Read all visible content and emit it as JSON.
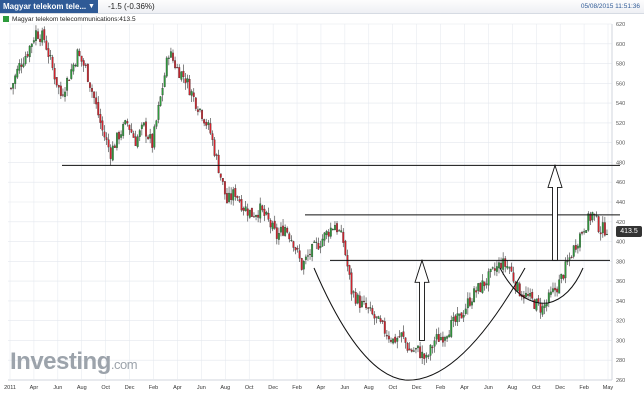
{
  "header": {
    "tab_title": "Magyar telekom tele...",
    "change": "-1.5 (-0.36%)",
    "timestamp": "05/08/2015 11:51:36"
  },
  "legend": {
    "label": "Magyar telekom telecommunications:413.5"
  },
  "price_tag": "413.5",
  "logo": {
    "main": "Investing",
    "suffix": ".com"
  },
  "colors": {
    "up": "#2e9b3c",
    "down": "#d3232d",
    "header_bg": "#2f5a96",
    "grid": "#e3e7ee"
  },
  "chart_data": {
    "type": "candlestick",
    "ylim": [
      260,
      620
    ],
    "y_ticks": [
      260,
      280,
      300,
      320,
      340,
      360,
      380,
      400,
      420,
      440,
      460,
      480,
      500,
      520,
      540,
      560,
      580,
      600,
      620
    ],
    "x_tick_labels": [
      "2011",
      "Apr",
      "Jun",
      "Aug",
      "Oct",
      "Dec",
      "Feb",
      "Apr",
      "Jun",
      "Aug",
      "Oct",
      "Dec",
      "Feb",
      "Apr",
      "Jun",
      "Aug",
      "Oct",
      "Dec",
      "Feb",
      "Apr",
      "Jun",
      "Aug",
      "Oct",
      "Dec",
      "Feb",
      "May"
    ],
    "price_path": [
      [
        0,
        555
      ],
      [
        4,
        578
      ],
      [
        8,
        592
      ],
      [
        12,
        612
      ],
      [
        16,
        605
      ],
      [
        20,
        575
      ],
      [
        24,
        548
      ],
      [
        28,
        568
      ],
      [
        32,
        590
      ],
      [
        36,
        575
      ],
      [
        40,
        545
      ],
      [
        44,
        512
      ],
      [
        48,
        490
      ],
      [
        52,
        508
      ],
      [
        56,
        520
      ],
      [
        60,
        502
      ],
      [
        64,
        516
      ],
      [
        68,
        498
      ],
      [
        72,
        545
      ],
      [
        76,
        592
      ],
      [
        80,
        575
      ],
      [
        84,
        565
      ],
      [
        88,
        545
      ],
      [
        92,
        530
      ],
      [
        96,
        510
      ],
      [
        100,
        475
      ],
      [
        104,
        440
      ],
      [
        108,
        450
      ],
      [
        112,
        435
      ],
      [
        116,
        428
      ],
      [
        120,
        432
      ],
      [
        124,
        420
      ],
      [
        128,
        405
      ],
      [
        132,
        415
      ],
      [
        136,
        400
      ],
      [
        140,
        375
      ],
      [
        144,
        388
      ],
      [
        148,
        398
      ],
      [
        152,
        408
      ],
      [
        156,
        418
      ],
      [
        160,
        400
      ],
      [
        164,
        350
      ],
      [
        168,
        338
      ],
      [
        172,
        330
      ],
      [
        176,
        320
      ],
      [
        180,
        310
      ],
      [
        184,
        300
      ],
      [
        188,
        305
      ],
      [
        192,
        290
      ],
      [
        196,
        290
      ],
      [
        200,
        280
      ],
      [
        204,
        300
      ],
      [
        208,
        305
      ],
      [
        212,
        315
      ],
      [
        216,
        322
      ],
      [
        220,
        338
      ],
      [
        224,
        350
      ],
      [
        228,
        358
      ],
      [
        232,
        368
      ],
      [
        236,
        378
      ],
      [
        240,
        374
      ],
      [
        244,
        352
      ],
      [
        248,
        345
      ],
      [
        252,
        338
      ],
      [
        256,
        332
      ],
      [
        260,
        345
      ],
      [
        264,
        358
      ],
      [
        268,
        378
      ],
      [
        272,
        398
      ],
      [
        276,
        415
      ],
      [
        280,
        428
      ],
      [
        284,
        412
      ],
      [
        287,
        413.5
      ]
    ],
    "resistance_lines": [
      477,
      427,
      381
    ],
    "annotation_arrows": [
      "up",
      "up"
    ]
  }
}
